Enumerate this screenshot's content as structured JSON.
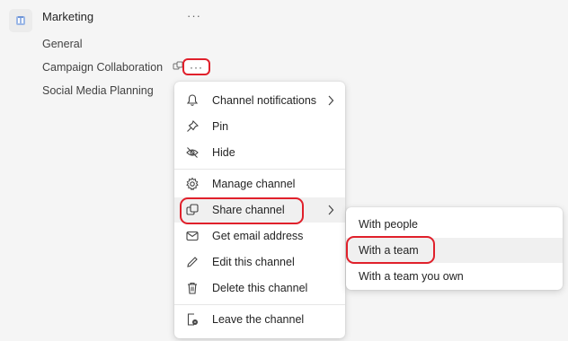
{
  "sidebar": {
    "team": {
      "name": "Marketing",
      "more": "···",
      "icon": "team-avatar-icon"
    },
    "channels": [
      {
        "label": "General"
      },
      {
        "label": "Campaign Collaboration",
        "shared_icon": "shared-channel-icon",
        "more": "···"
      },
      {
        "label": "Social Media Planning"
      }
    ]
  },
  "context_menu": {
    "items": [
      {
        "label": "Channel notifications",
        "icon": "bell-icon",
        "has_submenu": true
      },
      {
        "label": "Pin",
        "icon": "pin-icon"
      },
      {
        "label": "Hide",
        "icon": "hide-icon"
      },
      {
        "label": "Manage channel",
        "icon": "gear-icon"
      },
      {
        "label": "Share channel",
        "icon": "share-channel-icon",
        "has_submenu": true,
        "active": true
      },
      {
        "label": "Get email address",
        "icon": "mail-icon"
      },
      {
        "label": "Edit this channel",
        "icon": "pencil-icon"
      },
      {
        "label": "Delete this channel",
        "icon": "trash-icon"
      },
      {
        "label": "Leave the channel",
        "icon": "leave-icon"
      }
    ]
  },
  "share_submenu": {
    "items": [
      {
        "label": "With people"
      },
      {
        "label": "With a team",
        "active": true
      },
      {
        "label": "With a team you own"
      }
    ]
  },
  "colors": {
    "background": "#f5f5f5",
    "menu_bg": "#ffffff",
    "highlight_outline": "#e0202b",
    "hover_bg": "#f0f0f0",
    "text": "#242424"
  }
}
